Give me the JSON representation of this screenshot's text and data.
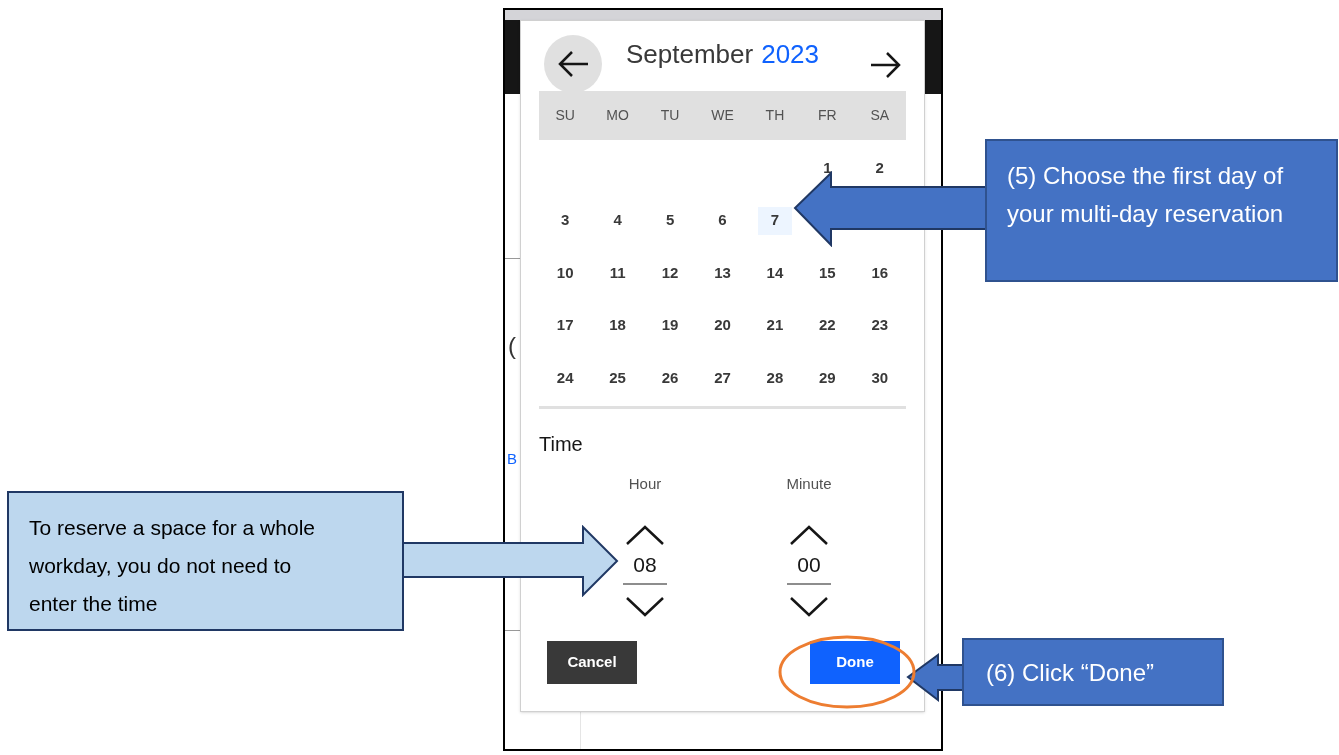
{
  "screenshot": {
    "background_fragments": [
      "(",
      "B"
    ],
    "date_picker": {
      "month": "September",
      "year": "2023",
      "weekdays": [
        "SU",
        "MO",
        "TU",
        "WE",
        "TH",
        "FR",
        "SA"
      ],
      "weeks": [
        {
          "days": [
            {
              "label": "1",
              "selected": false
            },
            {
              "label": "2",
              "selected": false
            }
          ]
        },
        {
          "days": [
            {
              "label": "3",
              "selected": false
            },
            {
              "label": "4",
              "selected": false
            },
            {
              "label": "5",
              "selected": false
            },
            {
              "label": "6",
              "selected": false
            },
            {
              "label": "7",
              "selected": true
            }
          ]
        },
        {
          "days": [
            {
              "label": "10",
              "selected": false
            },
            {
              "label": "11",
              "selected": false
            },
            {
              "label": "12",
              "selected": false
            },
            {
              "label": "13",
              "selected": false
            },
            {
              "label": "14",
              "selected": false
            },
            {
              "label": "15",
              "selected": false
            },
            {
              "label": "16",
              "selected": false
            }
          ]
        },
        {
          "days": [
            {
              "label": "17",
              "selected": false
            },
            {
              "label": "18",
              "selected": false
            },
            {
              "label": "19",
              "selected": false
            },
            {
              "label": "20",
              "selected": false
            },
            {
              "label": "21",
              "selected": false
            },
            {
              "label": "22",
              "selected": false
            },
            {
              "label": "23",
              "selected": false
            }
          ]
        },
        {
          "days": [
            {
              "label": "24",
              "selected": false
            },
            {
              "label": "25",
              "selected": false
            },
            {
              "label": "26",
              "selected": false
            },
            {
              "label": "27",
              "selected": false
            },
            {
              "label": "28",
              "selected": false
            },
            {
              "label": "29",
              "selected": false
            },
            {
              "label": "30",
              "selected": false
            }
          ]
        }
      ],
      "time": {
        "heading": "Time",
        "fields": [
          {
            "label": "Hour",
            "value": "08"
          },
          {
            "label": "Minute",
            "value": "00"
          }
        ]
      },
      "buttons": [
        {
          "kind": "secondary",
          "label": "Cancel"
        },
        {
          "kind": "primary",
          "label": "Done"
        }
      ]
    }
  },
  "annotations": [
    {
      "kind": "step",
      "text": "(5) Choose the first day of your multi-day reservation"
    },
    {
      "kind": "note",
      "text": "To reserve a space for a whole workday, you do not need to enter the time"
    },
    {
      "kind": "step",
      "text": "(6) Click “Done”"
    }
  ]
}
